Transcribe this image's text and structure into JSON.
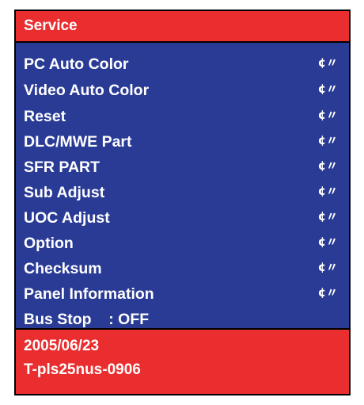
{
  "header": {
    "title": "Service"
  },
  "menu": {
    "items": [
      {
        "label": "PC Auto Color",
        "arrow": "¢〃"
      },
      {
        "label": "Video Auto Color",
        "arrow": "¢〃"
      },
      {
        "label": "Reset",
        "arrow": "¢〃"
      },
      {
        "label": "DLC/MWE Part",
        "arrow": "¢〃"
      },
      {
        "label": "SFR PART",
        "arrow": "¢〃"
      },
      {
        "label": "Sub Adjust",
        "arrow": "¢〃"
      },
      {
        "label": "UOC Adjust",
        "arrow": "¢〃"
      },
      {
        "label": "Option",
        "arrow": "¢〃"
      },
      {
        "label": "Checksum",
        "arrow": "¢〃"
      },
      {
        "label": "Panel Information",
        "arrow": "¢〃"
      },
      {
        "label": "Bus Stop    : OFF",
        "arrow": ""
      }
    ]
  },
  "footer": {
    "date": "2005/06/23",
    "version": "T-pls25nus-0906"
  },
  "colors": {
    "header_bg": "#ea2d2e",
    "menu_bg": "#2a3b96",
    "footer_bg": "#ea2d2e",
    "text": "#ffffff"
  }
}
